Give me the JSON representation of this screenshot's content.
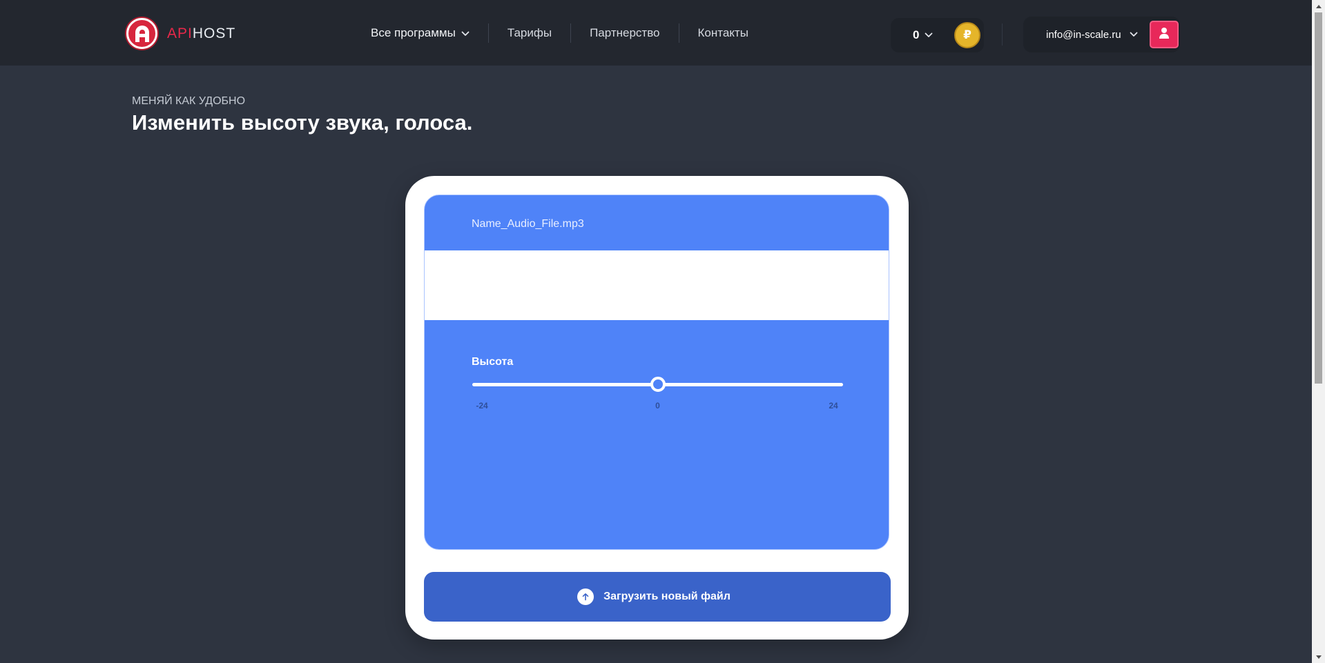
{
  "header": {
    "logo": {
      "api": "API",
      "host": "HOST",
      "icon": "apihost-logo-icon"
    },
    "nav": [
      {
        "label": "Все программы",
        "dropdown": true
      },
      {
        "label": "Тарифы"
      },
      {
        "label": "Партнерство"
      },
      {
        "label": "Контакты"
      }
    ],
    "balance": {
      "value": "0",
      "currency_symbol": "₽"
    },
    "account": {
      "email": "info@in-scale.ru",
      "icon": "user-icon"
    }
  },
  "page": {
    "eyebrow": "МЕНЯЙ КАК УДОБНО",
    "title": "Изменить высоту звука, голоса."
  },
  "editor": {
    "file_name": "Name_Audio_File.mp3",
    "pitch": {
      "label": "Высота",
      "min": -24,
      "max": 24,
      "value": 0,
      "ticks": [
        "-24",
        "0",
        "24"
      ]
    },
    "upload_label": "Загрузить новый файл",
    "upload_icon": "arrow-up-icon"
  },
  "colors": {
    "header_bg": "#23272f",
    "page_bg": "#2e3440",
    "panel": "#4f83f8",
    "button": "#3a63c9",
    "accent_red": "#e8285a",
    "coin": "#e5b52a"
  }
}
